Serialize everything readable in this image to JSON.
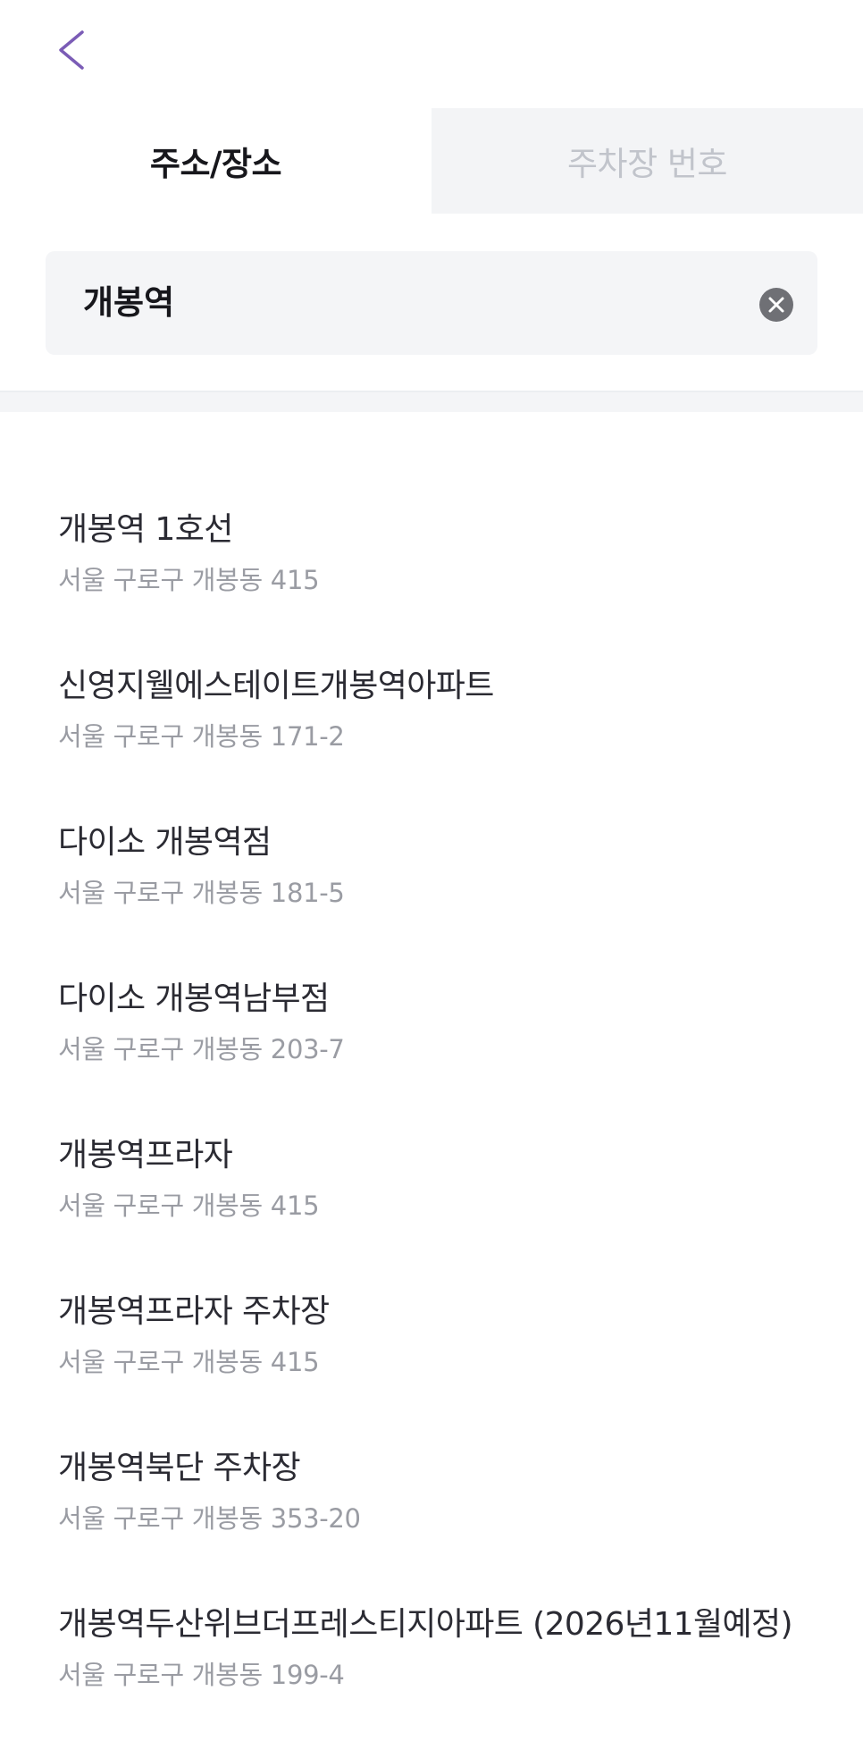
{
  "header": {
    "back_icon": "chevron-left-icon",
    "accent_color": "#7b5cb6"
  },
  "tabs": [
    {
      "label": "주소/장소",
      "selected": true
    },
    {
      "label": "주차장 번호",
      "selected": false
    }
  ],
  "search": {
    "value": "개봉역",
    "clear_icon": "clear-circle-icon"
  },
  "results": [
    {
      "name": "개봉역 1호선",
      "address": "서울 구로구 개봉동 415"
    },
    {
      "name": "신영지웰에스테이트개봉역아파트",
      "address": "서울 구로구 개봉동 171-2"
    },
    {
      "name": "다이소 개봉역점",
      "address": "서울 구로구 개봉동 181-5"
    },
    {
      "name": "다이소 개봉역남부점",
      "address": "서울 구로구 개봉동 203-7"
    },
    {
      "name": "개봉역프라자",
      "address": "서울 구로구 개봉동 415"
    },
    {
      "name": "개봉역프라자 주차장",
      "address": "서울 구로구 개봉동 415"
    },
    {
      "name": "개봉역북단 주차장",
      "address": "서울 구로구 개봉동 353-20"
    },
    {
      "name": "개봉역두산위브더프레스티지아파트 (2026년11월예정)",
      "address": "서울 구로구 개봉동 199-4"
    }
  ]
}
